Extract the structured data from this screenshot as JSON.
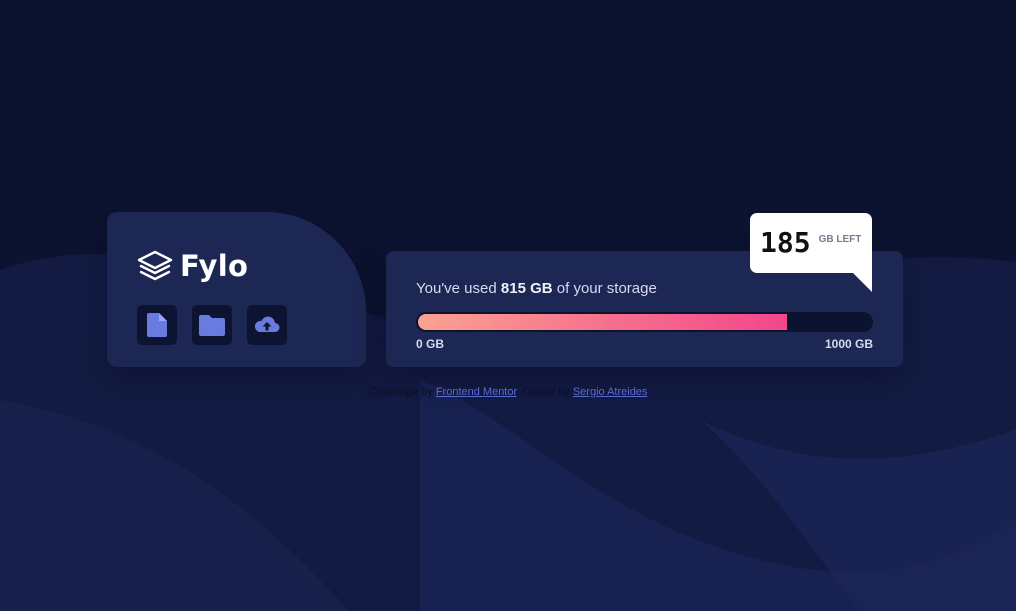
{
  "colors": {
    "page_background": "#0c1330",
    "wave_background": "#1a2250",
    "card_background": "#1c2753",
    "icon_button_background": "#0d1431",
    "icon_color": "#6a7be0",
    "bar_gradient_start": "#fca290",
    "bar_gradient_end": "#f3468b",
    "callout_background": "#ffffff",
    "link_color": "#5a6ad0"
  },
  "brand": {
    "logo_icon": "stacked-layers-icon",
    "name": "Fylo"
  },
  "toolbar": {
    "buttons": [
      {
        "icon": "document-icon"
      },
      {
        "icon": "folder-icon"
      },
      {
        "icon": "cloud-upload-icon"
      }
    ]
  },
  "storage": {
    "usage_prefix": "You've used",
    "used_amount": "815 GB",
    "usage_suffix": "of your storage",
    "used_fraction": 0.815,
    "min_label": "0 GB",
    "max_label": "1000 GB"
  },
  "callout": {
    "remaining_value": "185",
    "remaining_unit": "GB LEFT"
  },
  "attribution": {
    "challenge_prefix": "Challenge by",
    "challenge_link": "Frontend Mentor",
    "coded_prefix": "Coded by",
    "author_link": "Sergio Atreides"
  }
}
